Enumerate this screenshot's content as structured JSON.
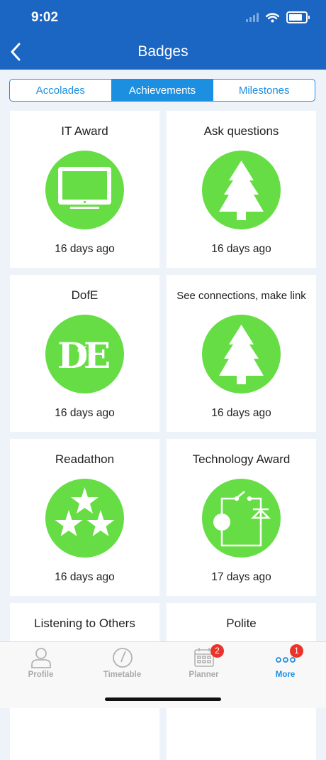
{
  "status_bar": {
    "time": "9:02"
  },
  "header": {
    "title": "Badges"
  },
  "segments": [
    {
      "label": "Accolades",
      "active": false
    },
    {
      "label": "Achievements",
      "active": true
    },
    {
      "label": "Milestones",
      "active": false
    }
  ],
  "badges": [
    {
      "name": "IT Award",
      "icon": "computer-monitor-icon",
      "date": "16 days ago"
    },
    {
      "name": "Ask questions",
      "icon": "pine-tree-icon",
      "date": "16 days ago"
    },
    {
      "name": "DofE",
      "icon": "dofe-logo-icon",
      "date": "16 days ago",
      "logo_text": "DofE"
    },
    {
      "name": "See connections, make link",
      "icon": "pine-tree-icon",
      "date": "16 days ago"
    },
    {
      "name": "Readathon",
      "icon": "three-stars-icon",
      "date": "16 days ago"
    },
    {
      "name": "Technology Award",
      "icon": "circuit-diagram-icon",
      "date": "17 days ago"
    },
    {
      "name": "Listening to Others",
      "icon": "",
      "date": ""
    },
    {
      "name": "Polite",
      "icon": "",
      "date": ""
    }
  ],
  "tabbar": {
    "items": [
      {
        "label": "Profile",
        "icon": "person-icon",
        "badge": ""
      },
      {
        "label": "Timetable",
        "icon": "clock-icon",
        "badge": ""
      },
      {
        "label": "Planner",
        "icon": "calendar-icon",
        "badge": "2"
      },
      {
        "label": "More",
        "icon": "more-dots-icon",
        "badge": "1"
      }
    ]
  },
  "colors": {
    "header_blue": "#1a66c2",
    "accent_blue": "#1d8fe0",
    "badge_green": "#66dd44",
    "notification_red": "#e8342a"
  }
}
